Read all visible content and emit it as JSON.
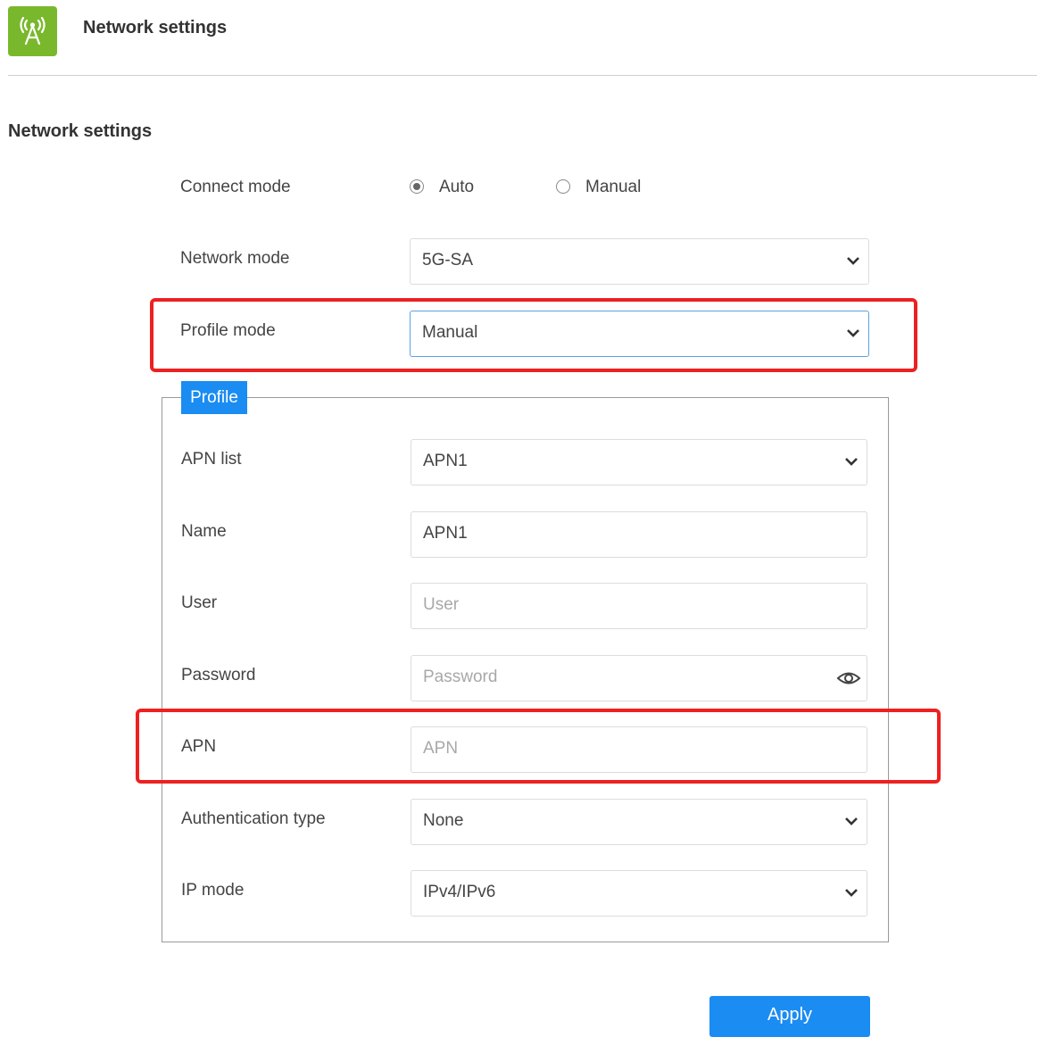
{
  "header": {
    "title": "Network settings",
    "icon": "antenna-icon",
    "icon_color": "#79b82d"
  },
  "section": {
    "title": "Network settings"
  },
  "connect_mode": {
    "label": "Connect mode",
    "options": [
      {
        "label": "Auto",
        "selected": true
      },
      {
        "label": "Manual",
        "selected": false
      }
    ]
  },
  "network_mode": {
    "label": "Network mode",
    "value": "5G-SA"
  },
  "profile_mode": {
    "label": "Profile mode",
    "value": "Manual"
  },
  "profile": {
    "tab_label": "Profile",
    "apn_list": {
      "label": "APN list",
      "value": "APN1"
    },
    "name": {
      "label": "Name",
      "value": "APN1"
    },
    "user": {
      "label": "User",
      "value": "",
      "placeholder": "User"
    },
    "password": {
      "label": "Password",
      "value": "",
      "placeholder": "Password"
    },
    "apn": {
      "label": "APN",
      "value": "",
      "placeholder": "APN"
    },
    "auth_type": {
      "label": "Authentication type",
      "value": "None"
    },
    "ip_mode": {
      "label": "IP mode",
      "value": "IPv4/IPv6"
    }
  },
  "apply_button": {
    "label": "Apply"
  },
  "colors": {
    "accent": "#1b8cf2",
    "highlight": "#ee2020",
    "brand": "#79b82d"
  }
}
